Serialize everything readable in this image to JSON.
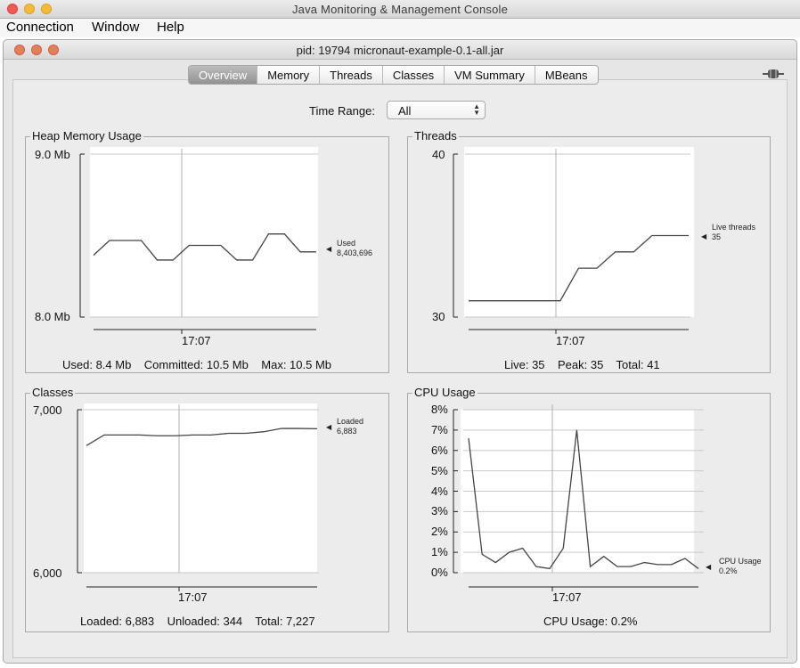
{
  "window": {
    "title": "Java Monitoring & Management Console"
  },
  "menu": [
    "Connection",
    "Window",
    "Help"
  ],
  "frame": {
    "title": "pid: 19794 micronaut-example-0.1-all.jar"
  },
  "tabs": [
    "Overview",
    "Memory",
    "Threads",
    "Classes",
    "VM Summary",
    "MBeans"
  ],
  "active_tab": "Overview",
  "time_range": {
    "label": "Time Range:",
    "value": "All"
  },
  "panels": {
    "heap": {
      "title": "Heap Memory Usage",
      "y_top": "9.0 Mb",
      "y_bottom": "8.0 Mb",
      "time": "17:07",
      "legend_name": "Used",
      "legend_value": "8,403,696",
      "summary": "Used: 8.4 Mb    Committed: 10.5 Mb    Max: 10.5 Mb"
    },
    "threads": {
      "title": "Threads",
      "y_top": "40",
      "y_bottom": "30",
      "time": "17:07",
      "legend_name": "Live threads",
      "legend_value": "35",
      "summary": "Live: 35    Peak: 35    Total: 41"
    },
    "classes": {
      "title": "Classes",
      "y_top": "7,000",
      "y_bottom": "6,000",
      "time": "17:07",
      "legend_name": "Loaded",
      "legend_value": "6,883",
      "summary": "Loaded: 6,883    Unloaded: 344    Total: 7,227"
    },
    "cpu": {
      "title": "CPU Usage",
      "y_ticks": [
        "8%",
        "7%",
        "6%",
        "5%",
        "4%",
        "3%",
        "2%",
        "1%",
        "0%"
      ],
      "time": "17:07",
      "legend_name": "CPU Usage",
      "legend_value": "0.2%",
      "summary": "CPU Usage: 0.2%"
    }
  },
  "chart_data": [
    {
      "type": "line",
      "title": "Heap Memory Usage",
      "ylabel": "Mb",
      "ylim": [
        8.0,
        9.0
      ],
      "series": [
        {
          "name": "Used",
          "values": [
            8.38,
            8.47,
            8.47,
            8.47,
            8.35,
            8.35,
            8.44,
            8.44,
            8.44,
            8.35,
            8.35,
            8.51,
            8.51,
            8.4,
            8.4
          ]
        }
      ]
    },
    {
      "type": "line",
      "title": "Threads",
      "ylim": [
        30,
        40
      ],
      "series": [
        {
          "name": "Live threads",
          "values": [
            31,
            31,
            31,
            31,
            31,
            31,
            33,
            33,
            34,
            34,
            35,
            35,
            35
          ]
        }
      ]
    },
    {
      "type": "line",
      "title": "Classes",
      "ylim": [
        6000,
        7000
      ],
      "series": [
        {
          "name": "Loaded",
          "values": [
            6780,
            6845,
            6845,
            6845,
            6840,
            6840,
            6845,
            6845,
            6855,
            6855,
            6865,
            6885,
            6885,
            6883
          ]
        }
      ]
    },
    {
      "type": "line",
      "title": "CPU Usage",
      "ylabel": "%",
      "ylim": [
        0,
        8
      ],
      "series": [
        {
          "name": "CPU Usage",
          "values": [
            6.6,
            0.9,
            0.5,
            1.0,
            1.2,
            0.3,
            0.2,
            1.2,
            7.0,
            0.3,
            0.8,
            0.3,
            0.3,
            0.5,
            0.4,
            0.4,
            0.7,
            0.2
          ]
        }
      ]
    }
  ]
}
